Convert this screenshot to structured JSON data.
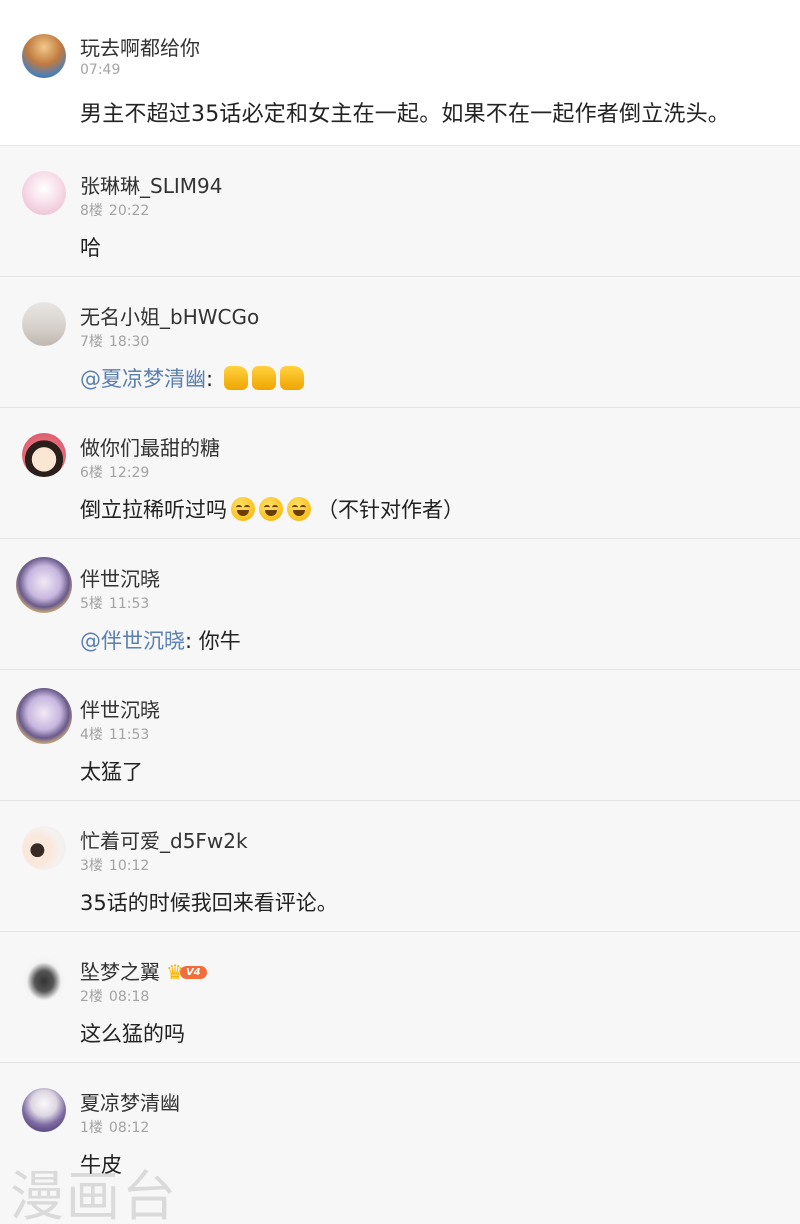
{
  "post": {
    "username": "玩去啊都给你",
    "time": "07:49",
    "text": "男主不超过35话必定和女主在一起。如果不在一起作者倒立洗头。",
    "avatar_icon": "castle-avatar"
  },
  "replies": [
    {
      "username": "张琳琳_SLIM94",
      "floor": "8楼",
      "time": "20:22",
      "text": "哈",
      "avatar_icon": "pink-anime-girl-avatar"
    },
    {
      "username": "无名小姐_bHWCGo",
      "floor": "7楼",
      "time": "18:30",
      "mention": "@夏凉梦清幽",
      "text": ": ",
      "emoji": "thumbs-up-icon",
      "emoji_count": 3,
      "avatar_icon": "beach-photo-avatar"
    },
    {
      "username": "做你们最甜的糖",
      "floor": "6楼",
      "time": "12:29",
      "text": "倒立拉稀听过吗",
      "text_after": "（不针对作者）",
      "emoji": "laugh-cry-icon",
      "emoji_count": 3,
      "avatar_icon": "chibi-boy-avatar"
    },
    {
      "username": "伴世沉晓",
      "floor": "5楼",
      "time": "11:53",
      "mention": "@伴世沉晓",
      "text": ": 你牛",
      "avatar_icon": "anime-character-avatar"
    },
    {
      "username": "伴世沉晓",
      "floor": "4楼",
      "time": "11:53",
      "text": "太猛了",
      "avatar_icon": "anime-character-avatar"
    },
    {
      "username": "忙着可爱_d5Fw2k",
      "floor": "3楼",
      "time": "10:12",
      "text": "35话的时候我回来看评论。",
      "avatar_icon": "couple-avatar"
    },
    {
      "username": "坠梦之翼",
      "floor": "2楼",
      "time": "08:18",
      "text": "这么猛的吗",
      "vip": "V4",
      "avatar_icon": "wings-avatar"
    },
    {
      "username": "夏凉梦清幽",
      "floor": "1楼",
      "time": "08:12",
      "text": "牛皮",
      "avatar_icon": "silver-hair-avatar"
    }
  ],
  "watermark": "漫画台",
  "colors": {
    "mention": "#5a7fb0",
    "meta": "#a3a3a3",
    "background": "#f7f7f8",
    "vip": "#f36d3a"
  }
}
